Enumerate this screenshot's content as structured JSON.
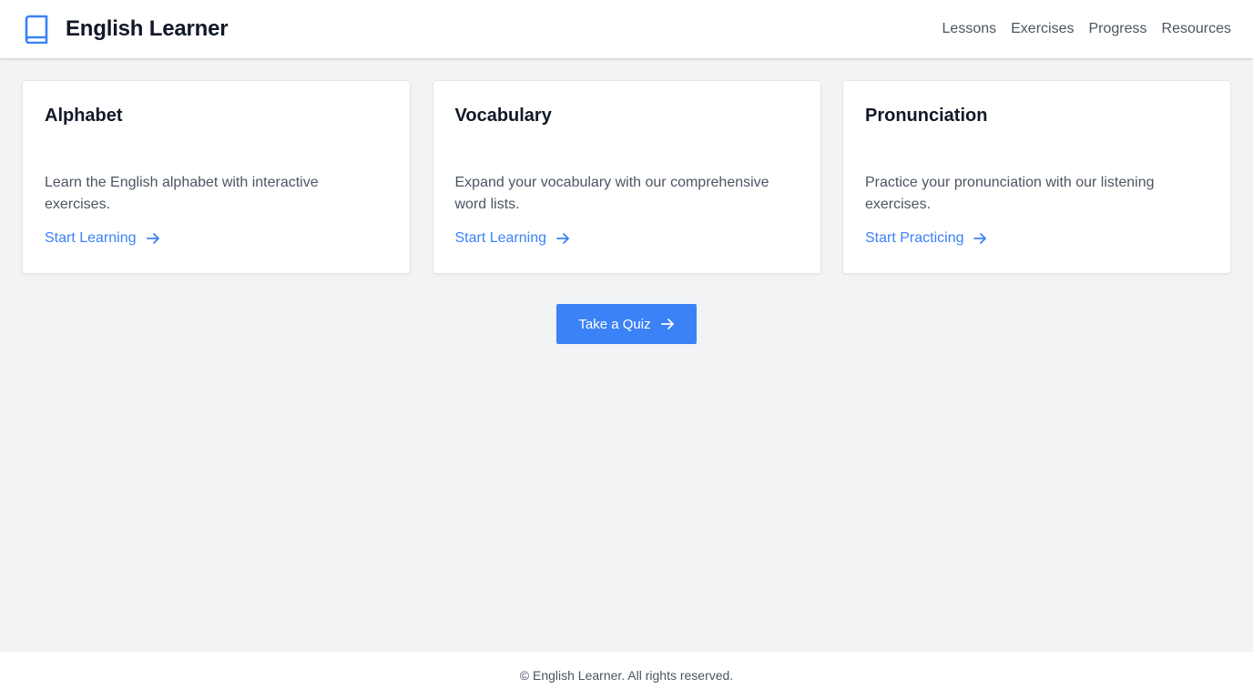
{
  "header": {
    "title": "English Learner",
    "logo_icon": "book-icon",
    "nav": [
      {
        "label": "Lessons"
      },
      {
        "label": "Exercises"
      },
      {
        "label": "Progress"
      },
      {
        "label": "Resources"
      }
    ]
  },
  "cards": [
    {
      "title": "Alphabet",
      "description": "Learn the English alphabet with interactive exercises.",
      "link_label": "Start Learning",
      "link_icon": "arrow-right-icon"
    },
    {
      "title": "Vocabulary",
      "description": "Expand your vocabulary with our comprehensive word lists.",
      "link_label": "Start Learning",
      "link_icon": "arrow-right-icon"
    },
    {
      "title": "Pronunciation",
      "description": "Practice your pronunciation with our listening exercises.",
      "link_label": "Start Practicing",
      "link_icon": "arrow-right-icon"
    }
  ],
  "quiz_button": {
    "label": "Take a Quiz",
    "icon": "arrow-right-icon"
  },
  "footer": {
    "text": "© English Learner. All rights reserved."
  },
  "colors": {
    "accent": "#3b82f6",
    "background": "#f2f3f5",
    "surface": "#ffffff",
    "text_primary": "#111827",
    "text_secondary": "#4b5563"
  }
}
